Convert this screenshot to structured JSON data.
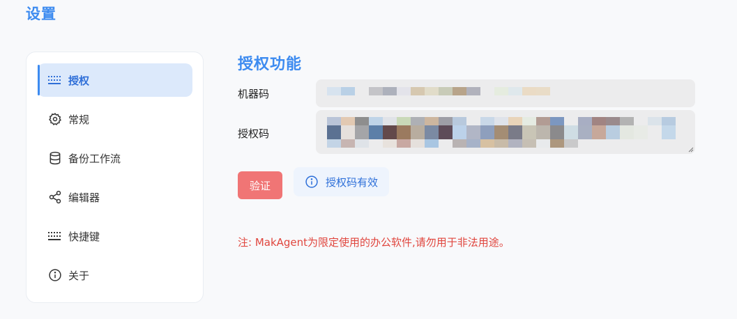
{
  "page": {
    "title": "设置"
  },
  "sidebar": {
    "items": [
      {
        "label": "授权",
        "icon": "keyboard-icon",
        "active": true
      },
      {
        "label": "常规",
        "icon": "gear-icon",
        "active": false
      },
      {
        "label": "备份工作流",
        "icon": "database-icon",
        "active": false
      },
      {
        "label": "编辑器",
        "icon": "share-nodes-icon",
        "active": false
      },
      {
        "label": "快捷键",
        "icon": "keyboard-icon",
        "active": false
      },
      {
        "label": "关于",
        "icon": "info-icon",
        "active": false
      }
    ]
  },
  "auth": {
    "section_title": "授权功能",
    "machine_code_label": "机器码",
    "license_code_label": "授权码",
    "verify_button": "验证",
    "status_text": "授权码有效",
    "note": "注: MakAgent为限定使用的办公软件,请勿用于非法用途。"
  },
  "colors": {
    "accent": "#3d8bf0",
    "verify_button": "#f07575",
    "note_text": "#e0463e",
    "active_nav_bg": "#dce9fb"
  }
}
